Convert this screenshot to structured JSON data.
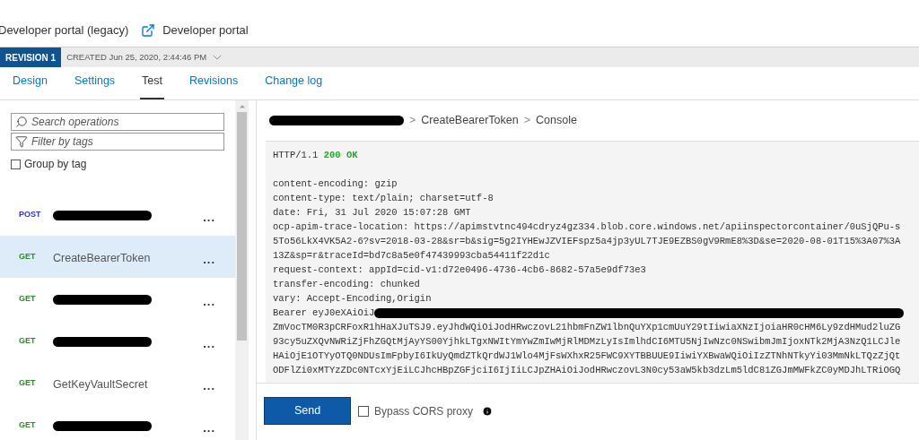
{
  "portal_links": [
    {
      "label": "Developer portal (legacy)",
      "icon": false
    },
    {
      "label": "Developer portal",
      "icon": true
    }
  ],
  "revision": {
    "badge": "REVISION 1",
    "created": "CREATED Jun 25, 2020, 2:44:46 PM"
  },
  "tabs": [
    {
      "label": "Design",
      "selected": false
    },
    {
      "label": "Settings",
      "selected": false
    },
    {
      "label": "Test",
      "selected": true
    },
    {
      "label": "Revisions",
      "selected": false
    },
    {
      "label": "Change log",
      "selected": false
    }
  ],
  "search": {
    "placeholder": "Search operations"
  },
  "filter": {
    "placeholder": "Filter by tags"
  },
  "group_by_tag": {
    "label": "Group by tag",
    "checked": false
  },
  "operations": [
    {
      "method": "POST",
      "redacted": true,
      "selected": false
    },
    {
      "method": "GET",
      "name": "CreateBearerToken",
      "redacted": false,
      "selected": true
    },
    {
      "method": "GET",
      "redacted": true,
      "selected": false
    },
    {
      "method": "GET",
      "redacted": true,
      "selected": false
    },
    {
      "method": "GET",
      "name": "GetKeyVaultSecret",
      "redacted": false,
      "selected": false
    },
    {
      "method": "GET",
      "redacted": true,
      "selected": false
    }
  ],
  "operation_menu": "...",
  "breadcrumb": {
    "redacted": true,
    "items": [
      "CreateBearerToken",
      "Console"
    ],
    "separator": ">"
  },
  "response": {
    "protocol": "HTTP/1.1",
    "status": "200 OK",
    "lines": [
      {
        "text": "content-encoding: gzip"
      },
      {
        "text": "content-type: text/plain; charset=utf-8"
      },
      {
        "text": "date: Fri, 31 Jul 2020 15:07:28 GMT"
      },
      {
        "text": "ocp-apim-trace-location: https://apimstvtnc494cdryz4gz334.blob.core.windows.net/apiinspectorcontainer/0uSjQPu-s"
      },
      {
        "text": "5To56LkX4VK5A2-6?sv=2018-03-28&sr=b&sig=5g2IYHEwJZVIEFspz5a4jp3yUL7TJE9EZBS0gV9RmE8%3D&se=2020-08-01T15%3A07%3A"
      },
      {
        "text": "13Z&sp=r&traceId=bd7c8a5e0f47439993cba54411f22d1c"
      },
      {
        "text": "request-context: appId=cid-v1:d72e0496-4736-4cb6-8682-57a5e9df73e3"
      },
      {
        "text": "transfer-encoding: chunked"
      },
      {
        "text": "vary: Accept-Encoding,Origin"
      },
      {
        "text": "Bearer eyJ0eXAiOiJ",
        "redacted": true
      },
      {
        "text": "ZmVocTM0R3pCRFoxR1hHaXJuTSJ9.eyJhdWQiOiJodHRwczovL21hbmFnZW1lbnQuYXp1cmUuY29tIiwiaXNzIjoiaHR0cHM6Ly9zdHMud2luZG"
      },
      {
        "text": "93cy5uZXQvNWRiZjFhZGQtMjAyYS00YjhkLTgxNWItYmYwZmIwMjRlMDMzLyIsImlhdCI6MTU5NjIwNzc0NSwibmJmIjoxNTk2MjA3NzQ1LCJle"
      },
      {
        "text": "HAiOjE1OTYyOTQ0NDUsImFpbyI6IkUyQmdZTkQrdWJ1Wlo4MjFsWXhxR25FWC9XYTBBUUE9IiwiYXBwaWQiOiIzZTNhNTkyYi03MmNkLTQzZjQt"
      },
      {
        "text": "ODFlZi0xMTYzZDc0NTcxYjEiLCJhcHBpZGFjciI6IjIiLCJpZHAiOiJodHRwczovL3N0cy53aW5kb3dzLm5ldC81ZGJmMWFkZC0yMDJhLTRiOGQ"
      }
    ]
  },
  "send_button": "Send",
  "bypass_cors": {
    "label": "Bypass CORS proxy",
    "checked": false
  }
}
